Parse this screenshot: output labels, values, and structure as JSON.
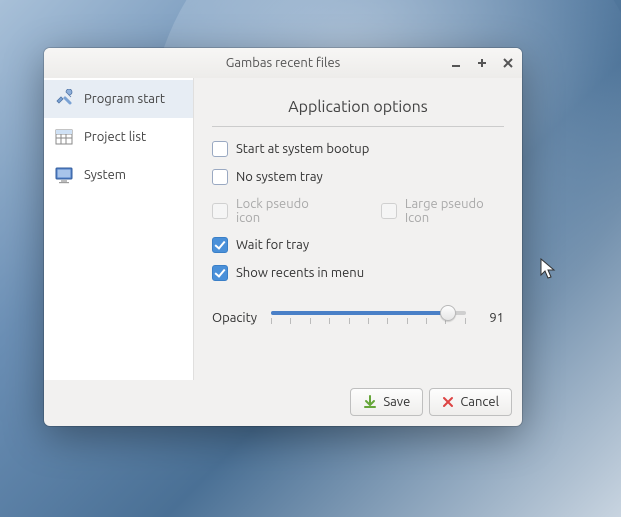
{
  "window": {
    "title": "Gambas recent files"
  },
  "sidebar": {
    "items": [
      {
        "label": "Program start",
        "selected": true,
        "icon": "tools"
      },
      {
        "label": "Project list",
        "selected": false,
        "icon": "table"
      },
      {
        "label": "System",
        "selected": false,
        "icon": "monitor"
      }
    ]
  },
  "main": {
    "section_title": "Application options",
    "options": {
      "start_bootup": {
        "label": "Start at system bootup",
        "checked": false,
        "enabled": true
      },
      "no_system_tray": {
        "label": "No system tray",
        "checked": false,
        "enabled": true
      },
      "lock_pseudo_icon": {
        "label": "Lock pseudo icon",
        "checked": false,
        "enabled": false
      },
      "large_pseudo_icon": {
        "label": "Large pseudo Icon",
        "checked": false,
        "enabled": false
      },
      "wait_for_tray": {
        "label": "Wait for tray",
        "checked": true,
        "enabled": true
      },
      "show_recents_menu": {
        "label": "Show recents in menu",
        "checked": true,
        "enabled": true
      }
    },
    "opacity": {
      "label": "Opacity",
      "value": "91"
    }
  },
  "footer": {
    "save_label": "Save",
    "cancel_label": "Cancel"
  }
}
